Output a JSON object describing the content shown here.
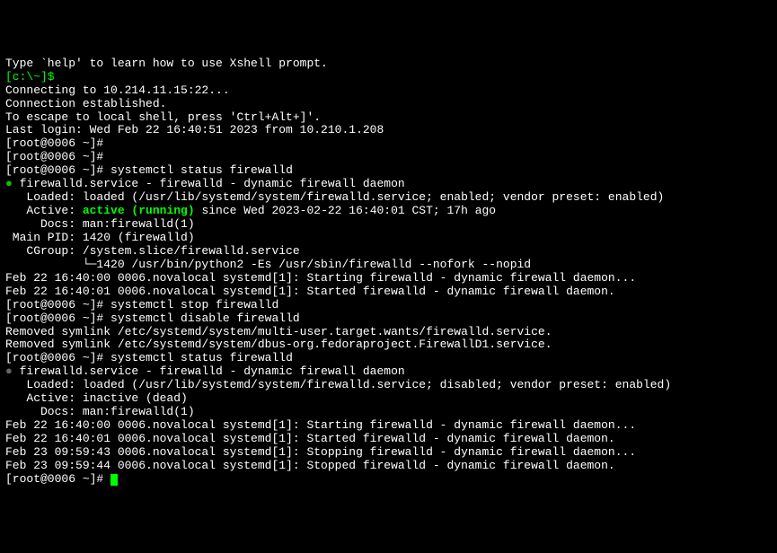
{
  "lines": {
    "help": "Type `help' to learn how to use Xshell prompt.",
    "localPrompt": "[c:\\~]$ ",
    "blank1": "",
    "connecting": "Connecting to 10.214.11.15:22...",
    "established": "Connection established.",
    "escape": "To escape to local shell, press 'Ctrl+Alt+]'.",
    "blank2": "",
    "lastLogin": "Last login: Wed Feb 22 16:40:51 2023 from 10.210.1.208",
    "prompt1": "[root@0006 ~]# ",
    "prompt2": "[root@0006 ~]# ",
    "prompt3": "[root@0006 ~]# ",
    "cmd1": "systemctl status firewalld",
    "svc1_dot": "● ",
    "svc1_title": "firewalld.service - firewalld - dynamic firewall daemon",
    "svc1_loaded": "   Loaded: loaded (/usr/lib/systemd/system/firewalld.service; enabled; vendor preset: enabled)",
    "svc1_active_label": "   Active: ",
    "svc1_active_status": "active (running)",
    "svc1_active_since": " since Wed 2023-02-22 16:40:01 CST; 17h ago",
    "svc1_docs": "     Docs: man:firewalld(1)",
    "svc1_pid": " Main PID: 1420 (firewalld)",
    "svc1_cgroup": "   CGroup: /system.slice/firewalld.service",
    "svc1_cgroup2": "           └─1420 /usr/bin/python2 -Es /usr/sbin/firewalld --nofork --nopid",
    "blank3": "",
    "log1": "Feb 22 16:40:00 0006.novalocal systemd[1]: Starting firewalld - dynamic firewall daemon...",
    "log2": "Feb 22 16:40:01 0006.novalocal systemd[1]: Started firewalld - dynamic firewall daemon.",
    "prompt4": "[root@0006 ~]# ",
    "cmd2": "systemctl stop firewalld",
    "prompt5": "[root@0006 ~]# ",
    "cmd3": "systemctl disable firewalld",
    "removed1": "Removed symlink /etc/systemd/system/multi-user.target.wants/firewalld.service.",
    "removed2": "Removed symlink /etc/systemd/system/dbus-org.fedoraproject.FirewallD1.service.",
    "prompt6": "[root@0006 ~]# ",
    "cmd4": "systemctl status firewalld",
    "svc2_dot": "● ",
    "svc2_title": "firewalld.service - firewalld - dynamic firewall daemon",
    "svc2_loaded": "   Loaded: loaded (/usr/lib/systemd/system/firewalld.service; disabled; vendor preset: enabled)",
    "svc2_active": "   Active: inactive (dead)",
    "svc2_docs": "     Docs: man:firewalld(1)",
    "blank4": "",
    "log3": "Feb 22 16:40:00 0006.novalocal systemd[1]: Starting firewalld - dynamic firewall daemon...",
    "log4": "Feb 22 16:40:01 0006.novalocal systemd[1]: Started firewalld - dynamic firewall daemon.",
    "log5": "Feb 23 09:59:43 0006.novalocal systemd[1]: Stopping firewalld - dynamic firewall daemon...",
    "log6": "Feb 23 09:59:44 0006.novalocal systemd[1]: Stopped firewalld - dynamic firewall daemon.",
    "prompt7": "[root@0006 ~]# "
  }
}
